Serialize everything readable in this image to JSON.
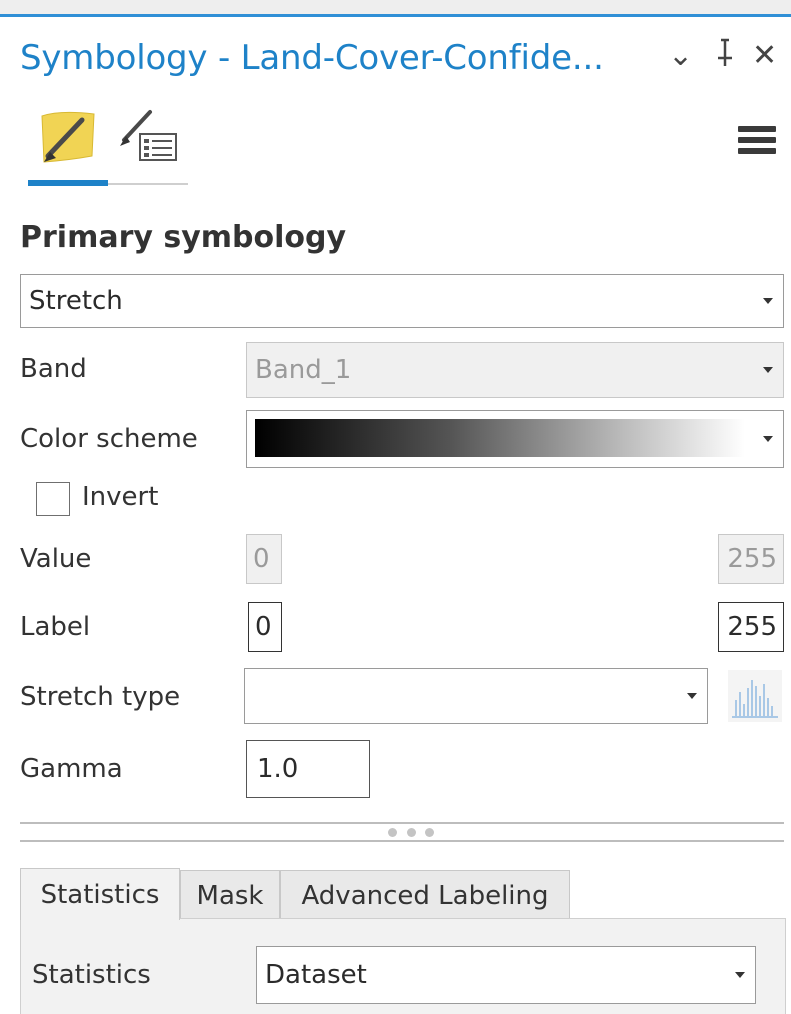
{
  "panel": {
    "title": "Symbology - Land-Cover-Confide...",
    "chevron_glyph": "⌄",
    "pin_glyph": "⊥",
    "close_glyph": "✕"
  },
  "tabs": [
    {
      "icon": "paintbrush-polygon-icon",
      "active": true
    },
    {
      "icon": "brush-legend-icon",
      "active": false
    }
  ],
  "heading": "Primary symbology",
  "symbology_type": "Stretch",
  "band": {
    "label": "Band",
    "value": "Band_1"
  },
  "color_scheme": {
    "label": "Color scheme",
    "gradient": [
      "#000000",
      "#ffffff"
    ]
  },
  "invert": {
    "label": "Invert",
    "checked": false
  },
  "value": {
    "label": "Value",
    "min": "0",
    "max": "255"
  },
  "label_row": {
    "label": "Label",
    "min": "0",
    "max": "255"
  },
  "stretch_type": {
    "label": "Stretch type",
    "value": ""
  },
  "gamma": {
    "label": "Gamma",
    "value": "1.0"
  },
  "subtabs": [
    {
      "label": "Statistics",
      "active": true
    },
    {
      "label": "Mask",
      "active": false
    },
    {
      "label": "Advanced Labeling",
      "active": false
    }
  ],
  "statistics": {
    "label": "Statistics",
    "value": "Dataset"
  },
  "colors": {
    "accent": "#1e82c8",
    "title": "#1e82c8"
  }
}
